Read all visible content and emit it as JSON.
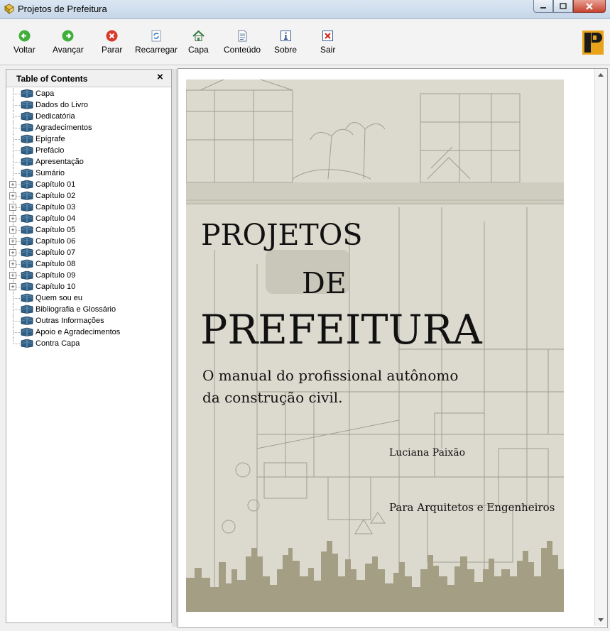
{
  "window": {
    "title": "Projetos de Prefeitura"
  },
  "toolbar": {
    "buttons": [
      {
        "label": "Voltar",
        "icon": "back-arrow-icon"
      },
      {
        "label": "Avançar",
        "icon": "forward-arrow-icon"
      },
      {
        "label": "Parar",
        "icon": "stop-icon"
      },
      {
        "label": "Recarregar",
        "icon": "refresh-icon"
      },
      {
        "label": "Capa",
        "icon": "home-icon"
      },
      {
        "label": "Conteúdo",
        "icon": "document-icon"
      },
      {
        "label": "Sobre",
        "icon": "info-icon"
      },
      {
        "label": "Sair",
        "icon": "exit-icon"
      }
    ]
  },
  "toc": {
    "title": "Table of Contents",
    "close": "×",
    "items": [
      {
        "label": "Capa",
        "expandable": false
      },
      {
        "label": "Dados do Livro",
        "expandable": false
      },
      {
        "label": "Dedicatória",
        "expandable": false
      },
      {
        "label": "Agradecimentos",
        "expandable": false
      },
      {
        "label": "Epígrafe",
        "expandable": false
      },
      {
        "label": "Prefácio",
        "expandable": false
      },
      {
        "label": "Apresentação",
        "expandable": false
      },
      {
        "label": "Sumário",
        "expandable": false
      },
      {
        "label": "Capítulo 01",
        "expandable": true
      },
      {
        "label": "Capítulo 02",
        "expandable": true
      },
      {
        "label": "Capítulo 03",
        "expandable": true
      },
      {
        "label": "Capítulo 04",
        "expandable": true
      },
      {
        "label": "Capítulo 05",
        "expandable": true
      },
      {
        "label": "Capítulo 06",
        "expandable": true
      },
      {
        "label": "Capítulo 07",
        "expandable": true
      },
      {
        "label": "Capítulo 08",
        "expandable": true
      },
      {
        "label": "Capítulo 09",
        "expandable": true
      },
      {
        "label": "Capítulo 10",
        "expandable": true
      },
      {
        "label": "Quem sou eu",
        "expandable": false
      },
      {
        "label": "Bibliografia e Glossário",
        "expandable": false
      },
      {
        "label": "Outras Informações",
        "expandable": false
      },
      {
        "label": "Apoio e Agradecimentos",
        "expandable": false
      },
      {
        "label": "Contra Capa",
        "expandable": false
      }
    ]
  },
  "cover": {
    "title_line1": "PROJETOS",
    "title_line2": "DE",
    "title_line3": "PREFEITURA",
    "subtitle_line1": "O manual do profissional autônomo",
    "subtitle_line2": "da construção civil.",
    "author": "Luciana Paixão",
    "audience": "Para Arquitetos e Engenheiros"
  },
  "colors": {
    "cover_bg": "#dcdace",
    "skyline": "#a39e84",
    "title_bar": "#c6d6e8",
    "book_icon": "#2e5f86"
  }
}
